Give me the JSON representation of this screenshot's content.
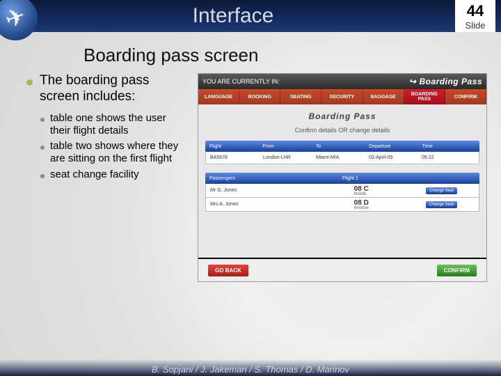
{
  "page": {
    "number": "44",
    "label": "Slide"
  },
  "title": "Interface",
  "subtitle": "Boarding pass screen",
  "main_bullet": "The boarding pass screen includes:",
  "sub_bullets": [
    "table one shows the user their flight details",
    "table two shows where they are sitting on the first flight",
    "seat change facility"
  ],
  "shot": {
    "topbar_left": "YOU ARE CURRENTLY IN:",
    "topbar_right": "Boarding Pass",
    "tabs": [
      "LANGUAGE",
      "BOOKING",
      "SEATING",
      "SECURITY",
      "BAGGAGE",
      "BOARDING PASS",
      "CONFIRM"
    ],
    "active_tab_index": 5,
    "heading": "Boarding  Pass",
    "subheading": "Confirm details OR change details",
    "flight_headers": [
      "Flight",
      "From",
      "To",
      "Departure",
      "Time"
    ],
    "flight_row": [
      "BA5678",
      "London-LHR",
      "Miami-MIA",
      "03-April-09",
      "05:22"
    ],
    "pass_headers": [
      "Passengers",
      "Flight 1",
      ""
    ],
    "pass_rows": [
      {
        "name": "Mr G. Jones",
        "seat": "08 C",
        "pos": "Middle",
        "btn": "Change Seat"
      },
      {
        "name": "Mrs A. Jones",
        "seat": "08 D",
        "pos": "Window",
        "btn": "Change Seat"
      }
    ],
    "go_back": "GO BACK",
    "confirm": "CONFIRM"
  },
  "footer": "B. Sopjani / J. Jakeman / S. Thomas / D. Marinov"
}
